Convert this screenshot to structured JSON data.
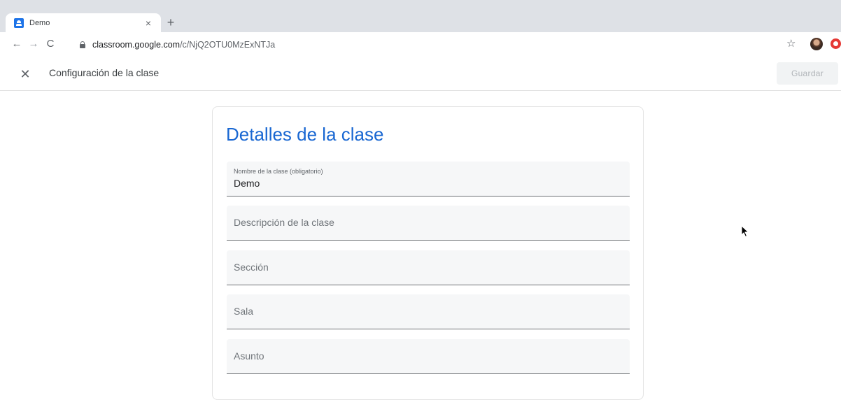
{
  "browser": {
    "tab": {
      "title": "Demo",
      "close_glyph": "×",
      "favicon": "google-classroom-icon"
    },
    "new_tab_glyph": "+",
    "nav": {
      "back": "←",
      "forward": "→",
      "reload": "C"
    },
    "url": {
      "host": "classroom.google.com",
      "path": "/c/NjQ2OTU0MzExNTJa"
    },
    "star_glyph": "☆"
  },
  "app_header": {
    "close_glyph": "✕",
    "title": "Configuración de la clase",
    "save_label": "Guardar"
  },
  "card": {
    "title": "Detalles de la clase",
    "fields": [
      {
        "label": "Nombre de la clase (obligatorio)",
        "value": "Demo"
      },
      {
        "placeholder": "Descripción de la clase"
      },
      {
        "placeholder": "Sección"
      },
      {
        "placeholder": "Sala"
      },
      {
        "placeholder": "Asunto"
      }
    ]
  },
  "colors": {
    "title_blue": "#1967d2",
    "tabstrip": "#dee1e6",
    "field_bg": "#f6f7f8"
  }
}
